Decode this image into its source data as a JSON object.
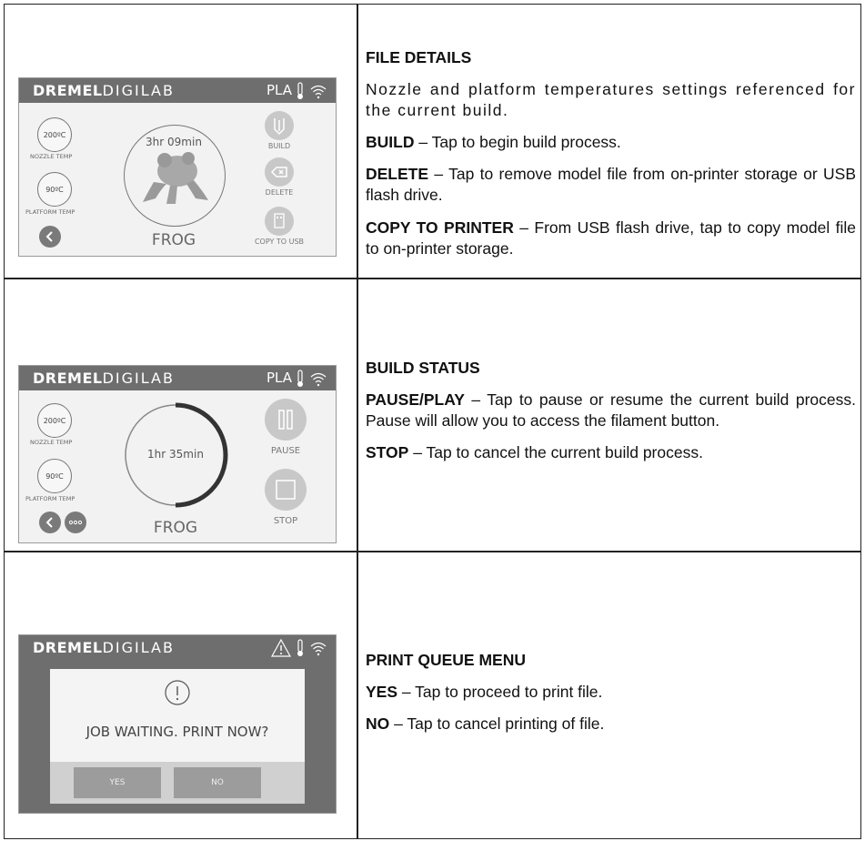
{
  "brand": {
    "bold": "DREMEL",
    "light": "DIGILAB"
  },
  "row1": {
    "screen": {
      "material": "PLA",
      "nozzle_temp": "200ºC",
      "nozzle_label": "NOZZLE TEMP",
      "platform_temp": "90ºC",
      "platform_label": "PLATFORM TEMP",
      "time": "3hr 09min",
      "file_name": "FROG",
      "build_label": "BUILD",
      "delete_label": "DELETE",
      "copy_label": "COPY TO USB"
    },
    "heading": "FILE DETAILS",
    "intro": "Nozzle and platform temperatures settings referenced for the current build.",
    "items": [
      {
        "term": "BUILD",
        "text": " – Tap to begin build process."
      },
      {
        "term": "DELETE",
        "text": " – Tap to remove model file from on-printer storage or USB flash drive."
      },
      {
        "term": "COPY TO PRINTER",
        "text": " – From USB flash drive, tap to copy model file to on-printer storage."
      }
    ]
  },
  "row2": {
    "screen": {
      "material": "PLA",
      "nozzle_temp": "200ºC",
      "nozzle_label": "NOZZLE TEMP",
      "platform_temp": "90ºC",
      "platform_label": "PLATFORM TEMP",
      "time": "1hr 35min",
      "file_name": "FROG",
      "pause_label": "PAUSE",
      "stop_label": "STOP"
    },
    "heading": "BUILD STATUS",
    "items": [
      {
        "term": "PAUSE/PLAY",
        "text": " – Tap to pause or resume the current build process. Pause will allow you to access the filament button."
      },
      {
        "term": "STOP",
        "text": " – Tap to cancel the current build process."
      }
    ]
  },
  "row3": {
    "screen": {
      "message": "JOB WAITING. PRINT NOW?",
      "yes_label": "YES",
      "no_label": "NO"
    },
    "heading": "PRINT QUEUE MENU",
    "items": [
      {
        "term": "YES",
        "text": " – Tap to proceed to print file."
      },
      {
        "term": "NO",
        "text": " – Tap to cancel printing of file."
      }
    ]
  }
}
